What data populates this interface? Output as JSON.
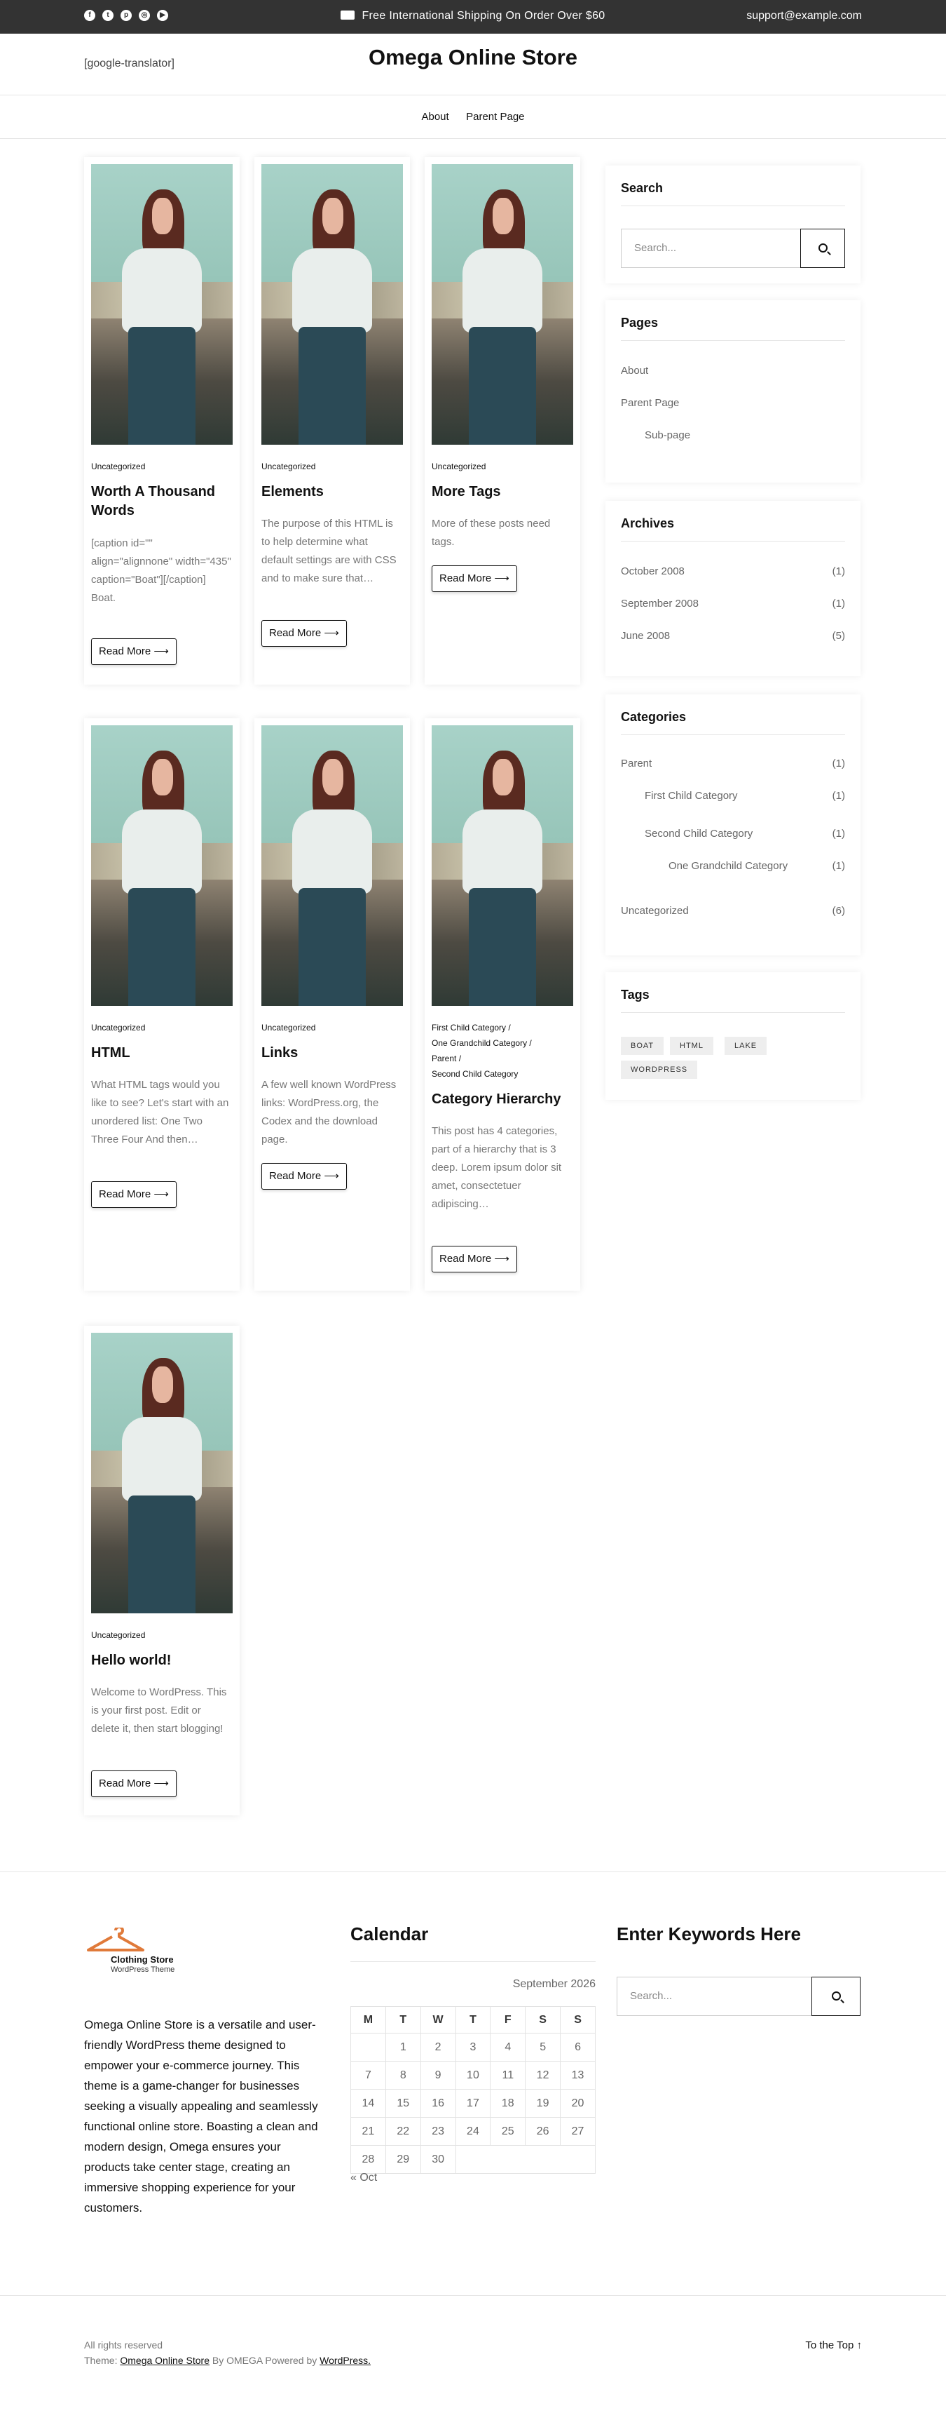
{
  "topbar": {
    "social_icons": [
      "facebook-icon",
      "twitter-icon",
      "pinterest-icon",
      "instagram-icon",
      "youtube-icon"
    ],
    "shipping": "Free International Shipping On Order Over $60",
    "email": "support@example.com"
  },
  "header": {
    "translator": "[google-translator]",
    "title": "Omega Online Store",
    "nav": [
      "About",
      "Parent Page"
    ]
  },
  "read_more": "Read More ⟶",
  "posts": [
    {
      "categories": [
        "Uncategorized"
      ],
      "title": "Worth A Thousand Words",
      "excerpt": "[caption id=\"\" align=\"alignnone\" width=\"435\" caption=\"Boat\"][/caption] Boat."
    },
    {
      "categories": [
        "Uncategorized"
      ],
      "title": "Elements",
      "excerpt": "The purpose of this HTML is to help determine what default settings are with CSS and to make sure that…"
    },
    {
      "categories": [
        "Uncategorized"
      ],
      "title": "More Tags",
      "excerpt": "More of these posts need tags."
    },
    {
      "categories": [
        "Uncategorized"
      ],
      "title": "HTML",
      "excerpt": "What HTML tags would you like to see? Let's start with an unordered list: One Two Three Four And then…"
    },
    {
      "categories": [
        "Uncategorized"
      ],
      "title": "Links",
      "excerpt": "A few well known WordPress links: WordPress.org, the Codex and the download page."
    },
    {
      "categories": [
        "First Child Category",
        "One Grandchild Category",
        "Parent",
        "Second Child Category"
      ],
      "title": "Category Hierarchy",
      "excerpt": "This post has 4 categories, part of a hierarchy that is 3 deep. Lorem ipsum dolor sit amet, consectetuer adipiscing…"
    },
    {
      "categories": [
        "Uncategorized"
      ],
      "title": "Hello world!",
      "excerpt": "Welcome to WordPress. This is your first post. Edit or delete it, then start blogging!"
    }
  ],
  "sidebar": {
    "search": {
      "title": "Search",
      "placeholder": "Search..."
    },
    "pages": {
      "title": "Pages",
      "items": [
        "About",
        "Parent Page",
        "Sub-page"
      ]
    },
    "archives": {
      "title": "Archives",
      "items": [
        {
          "label": "October 2008",
          "count": "(1)"
        },
        {
          "label": "September 2008",
          "count": "(1)"
        },
        {
          "label": "June 2008",
          "count": "(5)"
        }
      ]
    },
    "categories": {
      "title": "Categories",
      "items": [
        {
          "label": "Parent",
          "count": "(1)"
        },
        {
          "label": "First Child Category",
          "count": "(1)"
        },
        {
          "label": "Second Child Category",
          "count": "(1)"
        },
        {
          "label": "One Grandchild Category",
          "count": "(1)"
        },
        {
          "label": "Uncategorized",
          "count": "(6)"
        }
      ]
    },
    "tags": {
      "title": "Tags",
      "items": [
        "BOAT",
        "HTML",
        "LAKE",
        "WORDPRESS"
      ]
    }
  },
  "footer": {
    "logo_line1": "Clothing Store",
    "logo_line2": "WordPress Theme",
    "about": "Omega Online Store is a versatile and user-friendly WordPress theme designed to empower your e-commerce journey. This theme is a game-changer for businesses seeking a visually appealing and seamlessly functional online store. Boasting a clean and modern design, Omega ensures your products take center stage, creating an immersive shopping experience for your customers.",
    "calendar": {
      "title": "Calendar",
      "caption": "September 2026",
      "days": [
        "M",
        "T",
        "W",
        "T",
        "F",
        "S",
        "S"
      ],
      "weeks": [
        [
          "",
          "1",
          "2",
          "3",
          "4",
          "5",
          "6"
        ],
        [
          "7",
          "8",
          "9",
          "10",
          "11",
          "12",
          "13"
        ],
        [
          "14",
          "15",
          "16",
          "17",
          "18",
          "19",
          "20"
        ],
        [
          "21",
          "22",
          "23",
          "24",
          "25",
          "26",
          "27"
        ],
        [
          "28",
          "29",
          "30",
          "",
          "",
          "",
          ""
        ]
      ],
      "prev": "« Oct"
    },
    "keywords": {
      "title": "Enter Keywords Here",
      "placeholder": "Search..."
    },
    "copyright": "All rights reserved",
    "credits": {
      "prefix": "Theme:",
      "theme": "Omega Online Store",
      "by": "By OMEGA Powered by",
      "wp": "WordPress."
    },
    "to_top": "To the Top ↑"
  }
}
